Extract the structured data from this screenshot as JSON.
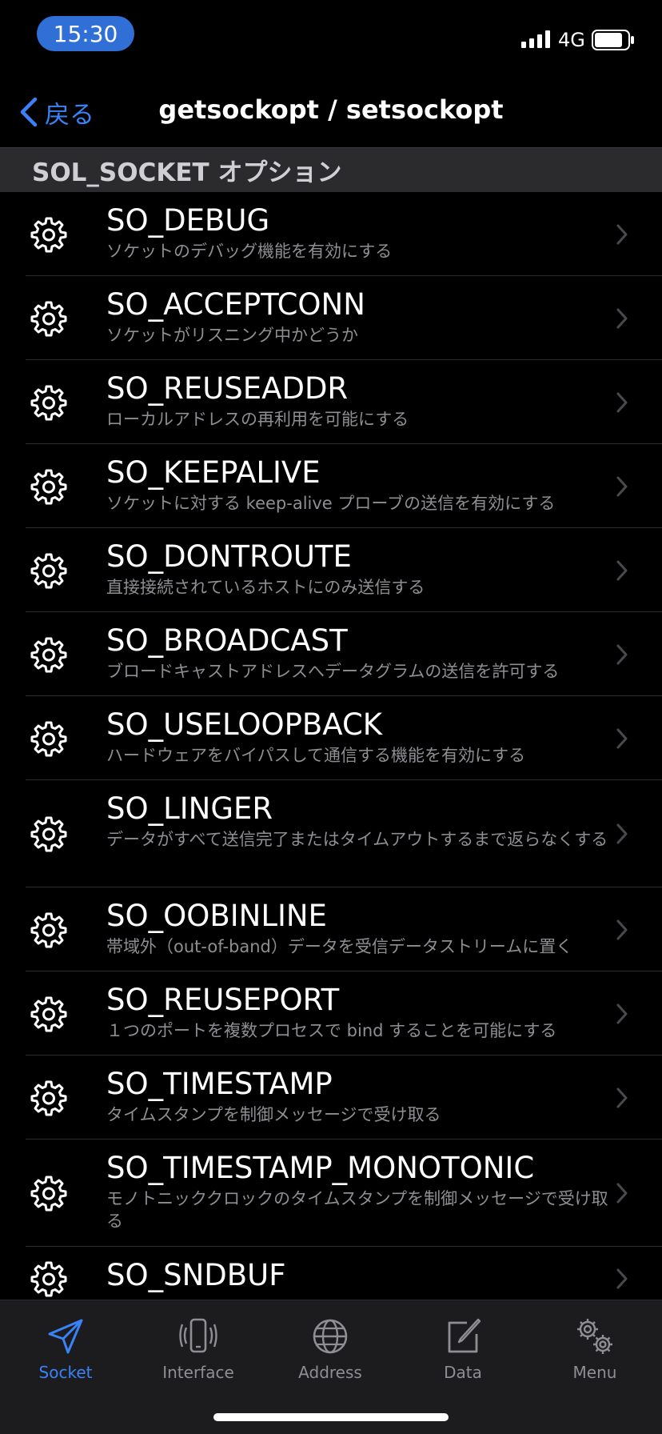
{
  "status_bar": {
    "time": "15:30",
    "network": "4G"
  },
  "nav": {
    "back_label": "戻る",
    "title": "getsockopt / setsockopt"
  },
  "section": {
    "header": "SOL_SOCKET オプション"
  },
  "options": [
    {
      "title": "SO_DEBUG",
      "subtitle": "ソケットのデバッグ機能を有効にする"
    },
    {
      "title": "SO_ACCEPTCONN",
      "subtitle": "ソケットがリスニング中かどうか"
    },
    {
      "title": "SO_REUSEADDR",
      "subtitle": "ローカルアドレスの再利用を可能にする"
    },
    {
      "title": "SO_KEEPALIVE",
      "subtitle": "ソケットに対する keep-alive プローブの送信を有効にする"
    },
    {
      "title": "SO_DONTROUTE",
      "subtitle": "直接接続されているホストにのみ送信する"
    },
    {
      "title": "SO_BROADCAST",
      "subtitle": "ブロードキャストアドレスへデータグラムの送信を許可する"
    },
    {
      "title": "SO_USELOOPBACK",
      "subtitle": "ハードウェアをバイパスして通信する機能を有効にする"
    },
    {
      "title": "SO_LINGER",
      "subtitle": "データがすべて送信完了またはタイムアウトするまで返らなくする"
    },
    {
      "title": "SO_OOBINLINE",
      "subtitle": "帯域外（out-of-band）データを受信データストリームに置く"
    },
    {
      "title": "SO_REUSEPORT",
      "subtitle": "１つのポートを複数プロセスで bind することを可能にする"
    },
    {
      "title": "SO_TIMESTAMP",
      "subtitle": "タイムスタンプを制御メッセージで受け取る"
    },
    {
      "title": "SO_TIMESTAMP_MONOTONIC",
      "subtitle": "モノトニッククロックのタイムスタンプを制御メッセージで受け取る"
    },
    {
      "title": "SO_SNDBUF",
      "subtitle": ""
    }
  ],
  "tabs": [
    {
      "label": "Socket",
      "icon": "paper-plane-icon",
      "active": true
    },
    {
      "label": "Interface",
      "icon": "phone-vibrate-icon",
      "active": false
    },
    {
      "label": "Address",
      "icon": "globe-icon",
      "active": false
    },
    {
      "label": "Data",
      "icon": "compose-icon",
      "active": false
    },
    {
      "label": "Menu",
      "icon": "gears-icon",
      "active": false
    }
  ],
  "colors": {
    "accent": "#3a82f7",
    "background": "#000000",
    "tab_bar": "#1c1c1e",
    "section_header": "#2b2b2e"
  }
}
